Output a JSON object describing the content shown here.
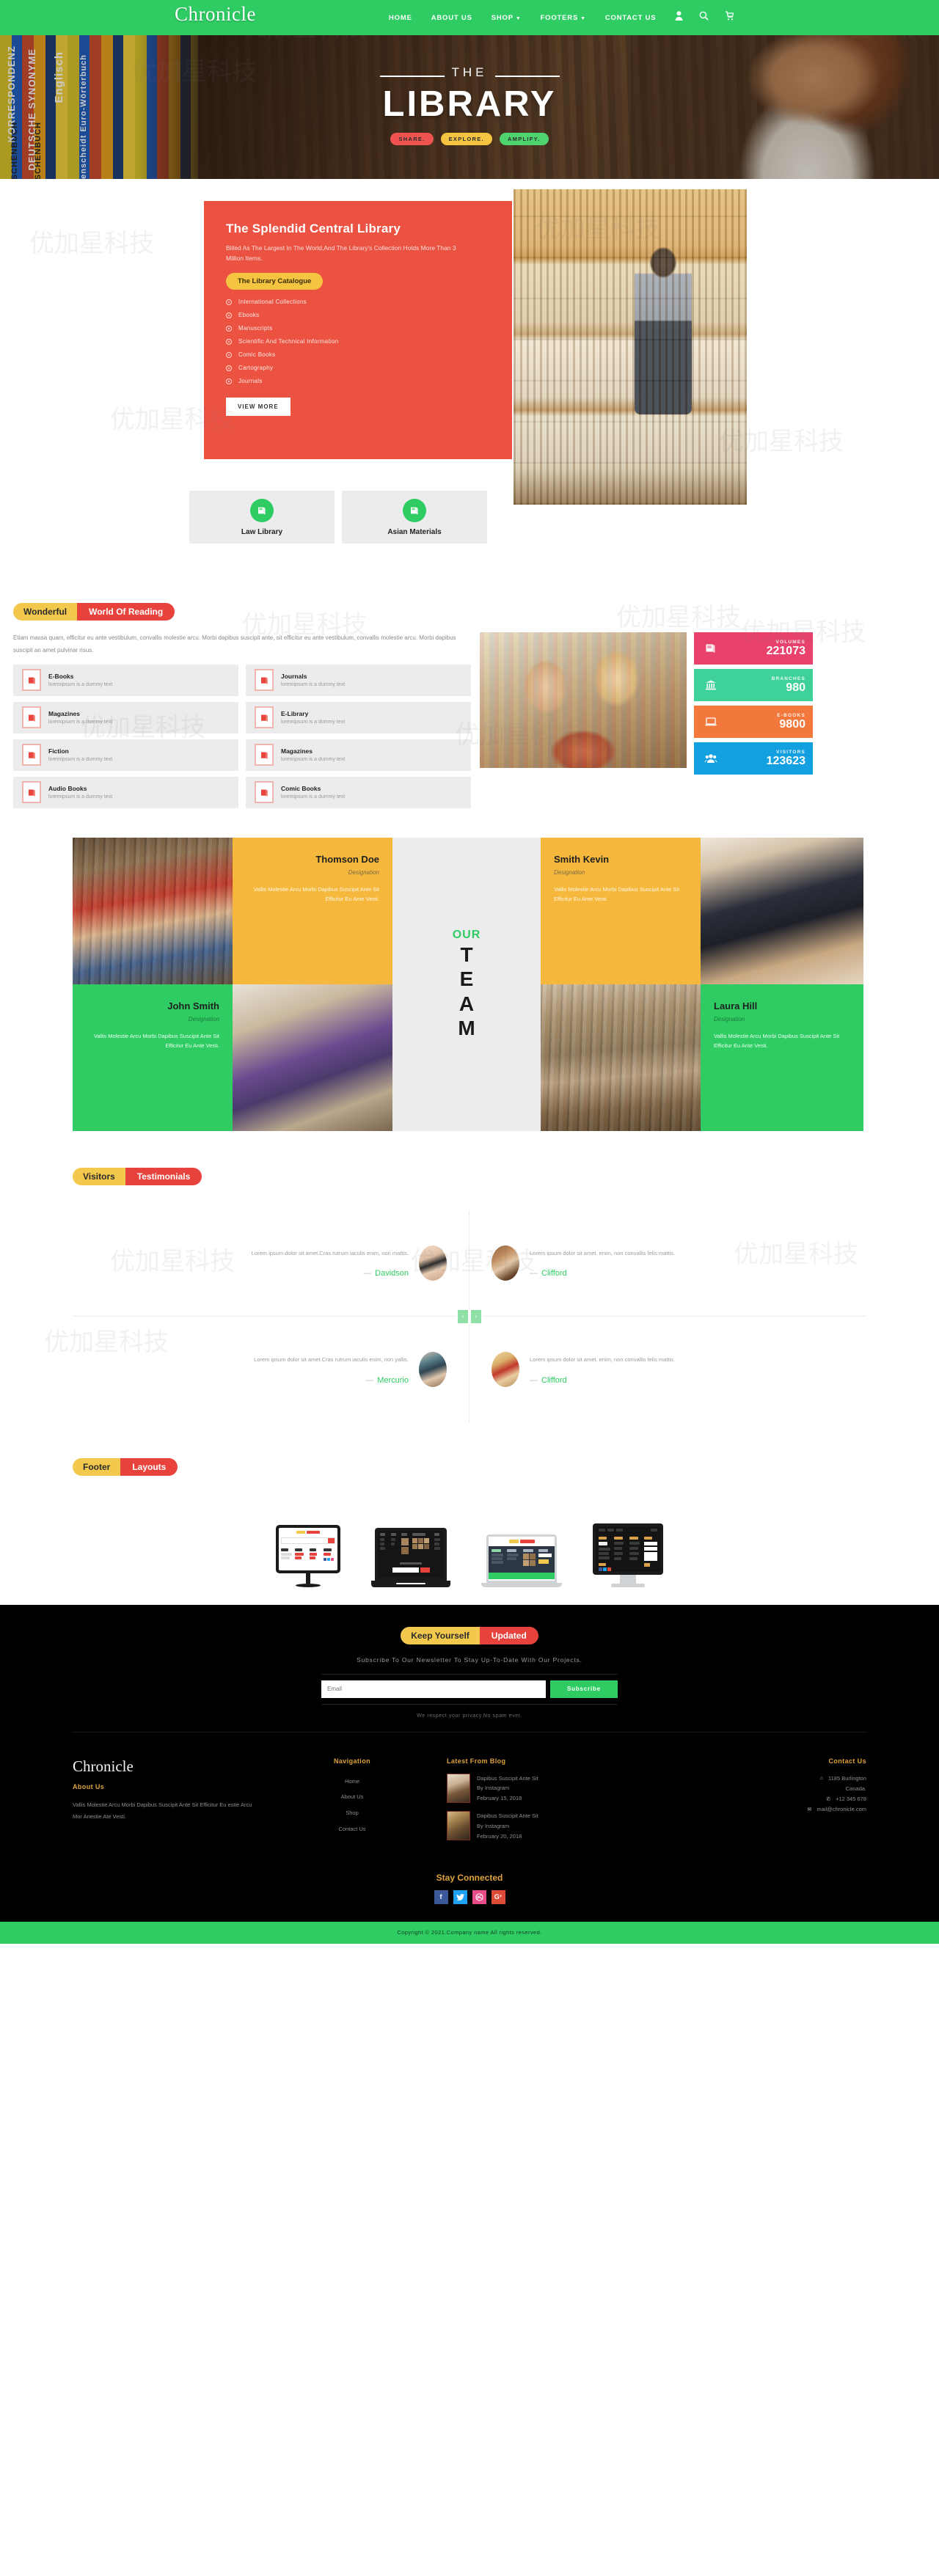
{
  "header": {
    "brand": "Chronicle",
    "nav": [
      {
        "label": "HOME",
        "caret": false
      },
      {
        "label": "ABOUT US",
        "caret": false
      },
      {
        "label": "SHOP",
        "caret": true
      },
      {
        "label": "FOOTERS",
        "caret": true
      },
      {
        "label": "CONTACT US",
        "caret": false
      }
    ],
    "icons": [
      "user-icon",
      "search-icon",
      "cart-icon"
    ]
  },
  "hero": {
    "eyebrow": "THE",
    "title": "LIBRARY",
    "badges": [
      {
        "label": "SHARE.",
        "color": "#ef5350"
      },
      {
        "label": "EXPLORE.",
        "color": "#f5c542"
      },
      {
        "label": "AMPLIFY.",
        "color": "#4fd36f"
      }
    ],
    "spines": [
      "KORRESPONDENZ",
      "DEUTSCHE SYNONYME",
      "Englisch",
      "Langenscheidt Euro-Wörterbuch",
      "SCHENBUCH",
      "SCHENBUCH"
    ]
  },
  "splendid": {
    "title": "The Splendid Central Library",
    "subtitle": "Billed As The Largest In The World,And The Library's Collection Holds More Than 3 Million Items.",
    "catalogue_pill": "The Library Catalogue",
    "items": [
      "International Collections",
      "Ebooks",
      "Manuscripts",
      "Scientific And Technical Information",
      "Comic Books",
      "Cartography",
      "Journals"
    ],
    "button": "VIEW MORE",
    "tiles": [
      {
        "label": "Law Library",
        "icon": "book-icon"
      },
      {
        "label": "Asian Materials",
        "icon": "book-icon"
      }
    ]
  },
  "wonderful": {
    "pill_left": "Wonderful",
    "pill_right": "World Of Reading",
    "description": "Etiam massa quam, efficitur eu ante vestibulum, convallis molestie arcu. Morbi dapibus suscipit ante, sit efficitur eu ante vestibulum, convallis molestie arcu. Morbi dapibus suscipit an amet pulvinar risus.",
    "features": [
      {
        "title": "E-Books",
        "desc": "loremipsum is a dummy text"
      },
      {
        "title": "Journals",
        "desc": "loremipsum is a dummy text"
      },
      {
        "title": "Magazines",
        "desc": "loremipsum is a dummy text"
      },
      {
        "title": "E-Library",
        "desc": "loremipsum is a dummy text"
      },
      {
        "title": "Fiction",
        "desc": "loremipsum is a dummy text"
      },
      {
        "title": "Magazines",
        "desc": "loremipsum is a dummy text"
      },
      {
        "title": "Audio Books",
        "desc": "loremipsum is a dummy text"
      },
      {
        "title": "Comic Books",
        "desc": "loremipsum is a dummy text"
      }
    ],
    "stats": [
      {
        "label": "VOLUMES",
        "value": "221073",
        "color": "#e8416b",
        "icon": "book-icon"
      },
      {
        "label": "BRANCHES",
        "value": "980",
        "color": "#3fd19a",
        "icon": "bank-icon"
      },
      {
        "label": "E-BOOKS",
        "value": "9800",
        "color": "#f2783c",
        "icon": "laptop-icon"
      },
      {
        "label": "VISITORS",
        "value": "123623",
        "color": "#13a0e0",
        "icon": "people-icon"
      }
    ]
  },
  "team": {
    "center_top": "OUR",
    "center_letters": [
      "T",
      "E",
      "A",
      "M"
    ],
    "members": [
      {
        "name": "Thomson Doe",
        "designation": "Designation",
        "bio": "Vallis Molestie Arcu Morbi Dapibus Suscipit Ante Sit Efficitur Eu Ante Vesti.",
        "color": "amber"
      },
      {
        "name": "Smith Kevin",
        "designation": "Designation",
        "bio": "Vallis Molestie Arcu Morbi Dapibus Suscipit Ante Sit Efficitur Eu Ante Vesti.",
        "color": "amber"
      },
      {
        "name": "John Smith",
        "designation": "Designation",
        "bio": "Vallis Molestie Arcu Morbi Dapibus Suscipit Ante Sit Efficitur Eu Ante Vesti.",
        "color": "green"
      },
      {
        "name": "Laura Hill",
        "designation": "Designation",
        "bio": "Vallis Molestie Arcu Morbi Dapibus Suscipit Ante Sit Efficitur Eu Ante Vesti.",
        "color": "green"
      }
    ]
  },
  "testimonials": {
    "pill_left": "Visitors",
    "pill_right": "Testimonials",
    "prev": "‹",
    "next": "›",
    "items": [
      {
        "text": "Lorem ipsum dolor sit amet.Cras rutrum iaculis enim, non mattis.",
        "name": "Davidson"
      },
      {
        "text": "Lorem ipsum dolor sit amet. enim, non convallis felis mattis.",
        "name": "Clifford"
      },
      {
        "text": "Lorem ipsum dolor sit amet.Cras rutrum iaculis enim, non yallis.",
        "name": "Mercurio"
      },
      {
        "text": "Lorem ipsum dolor sit amet. enim, non convallis felis mattis.",
        "name": "Clifford"
      }
    ]
  },
  "layouts": {
    "pill_left": "Footer",
    "pill_right": "Layouts",
    "devices": [
      "monitor-mockup",
      "laptop-mockup",
      "notebook-mockup",
      "imac-mockup"
    ]
  },
  "newsletter": {
    "pill_left": "Keep Yourself",
    "pill_right": "Updated",
    "subtitle": "Subscribe To Our Newsletter To Stay Up-To-Date With Our Projects.",
    "placeholder": "Email",
    "value": "",
    "button": "Subscribe",
    "note": "We respect your privacy.No spam ever."
  },
  "footer": {
    "brand": "Chronicle",
    "about_title": "About Us",
    "about_text": "Vallis Molestie Arcu Morbi Dapibus Suscipit Ante Sit Efficitur Eu estie Arcu Mor Anestie Ate Vesti.",
    "nav_title": "Navigation",
    "nav_links": [
      "Home",
      "About Us",
      "Shop",
      "Contact Us"
    ],
    "blog_title": "Latest From Blog",
    "blog": [
      {
        "title": "Dapibus Suscipit Ante Sit",
        "by": "By Instagram",
        "date": "February 15, 2018"
      },
      {
        "title": "Dapibus Suscipit Ante Sit",
        "by": "By Instagram",
        "date": "February 20, 2018"
      }
    ],
    "contact_title": "Contact Us",
    "contact": [
      {
        "icon": "home-icon",
        "line1": "1185 Burlington",
        "line2": "Canada."
      },
      {
        "icon": "phone-icon",
        "line1": "+12 345 678",
        "line2": ""
      },
      {
        "icon": "mail-icon",
        "line1": "mail@chronicle.com",
        "line2": ""
      }
    ],
    "social_title": "Stay Connected",
    "social": [
      {
        "name": "facebook-icon",
        "glyph": "f",
        "color": "#3b5998"
      },
      {
        "name": "twitter-icon",
        "glyph": "🐦",
        "color": "#1da1f2"
      },
      {
        "name": "dribbble-icon",
        "glyph": "◎",
        "color": "#ea4c89"
      },
      {
        "name": "googleplus-icon",
        "glyph": "G+",
        "color": "#dd4b39"
      }
    ],
    "copyright": "Copyright © 2021.Company name All rights reserved."
  }
}
